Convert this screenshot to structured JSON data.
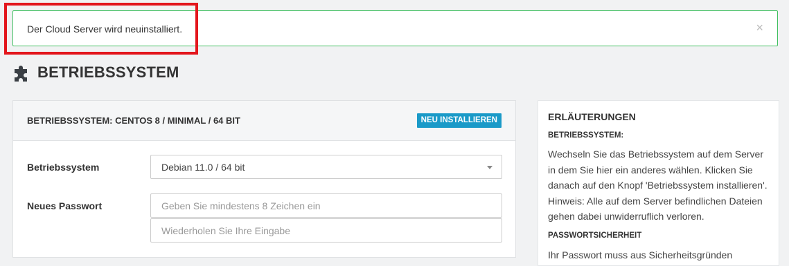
{
  "alert": {
    "message": "Der Cloud Server wird neuinstalliert.",
    "close": "×"
  },
  "page": {
    "title": "BETRIEBSSYSTEM",
    "icon": "puzzle-piece-icon"
  },
  "panel": {
    "title": "BETRIEBSSYSTEM: CENTOS 8 / MINIMAL / 64 BIT",
    "reinstall_button": "NEU INSTALLIEREN",
    "os_label": "Betriebssystem",
    "os_selected": "Debian 11.0 / 64 bit",
    "password_label": "Neues Passwort",
    "password_placeholder": "Geben Sie mindestens 8 Zeichen ein",
    "password_repeat_placeholder": "Wiederholen Sie Ihre Eingabe"
  },
  "sidebar": {
    "title": "ERLÄUTERUNGEN",
    "section1_title": "BETRIEBSSYSTEM:",
    "section1_text": "Wechseln Sie das Betriebssystem auf dem Server in dem Sie hier ein anderes wählen. Klicken Sie danach auf den Knopf 'Betriebssystem installieren'. Hinweis: Alle auf dem Server befindlichen Dateien gehen dabei unwiderruflich verloren.",
    "section2_title": "PASSWORTSICHERHEIT",
    "section2_text": "Ihr Passwort muss aus Sicherheitsgründen"
  },
  "colors": {
    "alert_border": "#3fbf5f",
    "highlight": "#e3161c",
    "button": "#1a9ac8"
  }
}
